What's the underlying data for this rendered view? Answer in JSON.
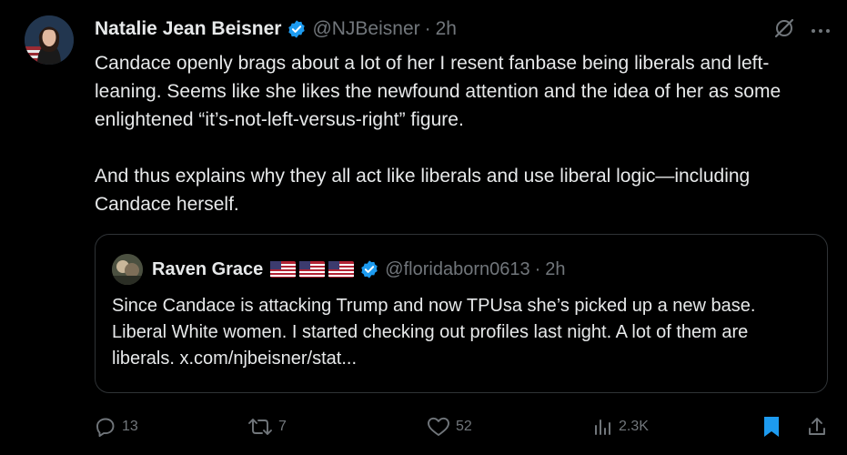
{
  "tweet": {
    "author_name": "Natalie Jean Beisner",
    "handle": "@NJBeisner",
    "separator": "·",
    "time": "2h",
    "paragraph1": "Candace openly brags about a lot of her I resent fanbase being liberals and left-leaning. Seems like she likes the newfound attention and the idea of her as some enlightened “it’s-not-left-versus-right” figure.",
    "paragraph2": "And thus explains why they all act like liberals and use liberal logic—including Candace herself."
  },
  "quote": {
    "author_name": "Raven Grace",
    "handle": "@floridaborn0613",
    "separator": "·",
    "time": "2h",
    "flags": [
      "us-flag",
      "us-flag",
      "us-flag"
    ],
    "text": "Since Candace is attacking Trump and now TPUsa she’s picked up a new base.  Liberal White women.  I started checking out profiles last night.   A lot of them are liberals. x.com/njbeisner/stat..."
  },
  "actions": {
    "replies": "13",
    "reposts": "7",
    "likes": "52",
    "views": "2.3K"
  },
  "colors": {
    "background": "#000000",
    "text": "#e7e9ea",
    "muted": "#71767b",
    "accent": "#1d9bf0",
    "border": "#2f3336"
  }
}
